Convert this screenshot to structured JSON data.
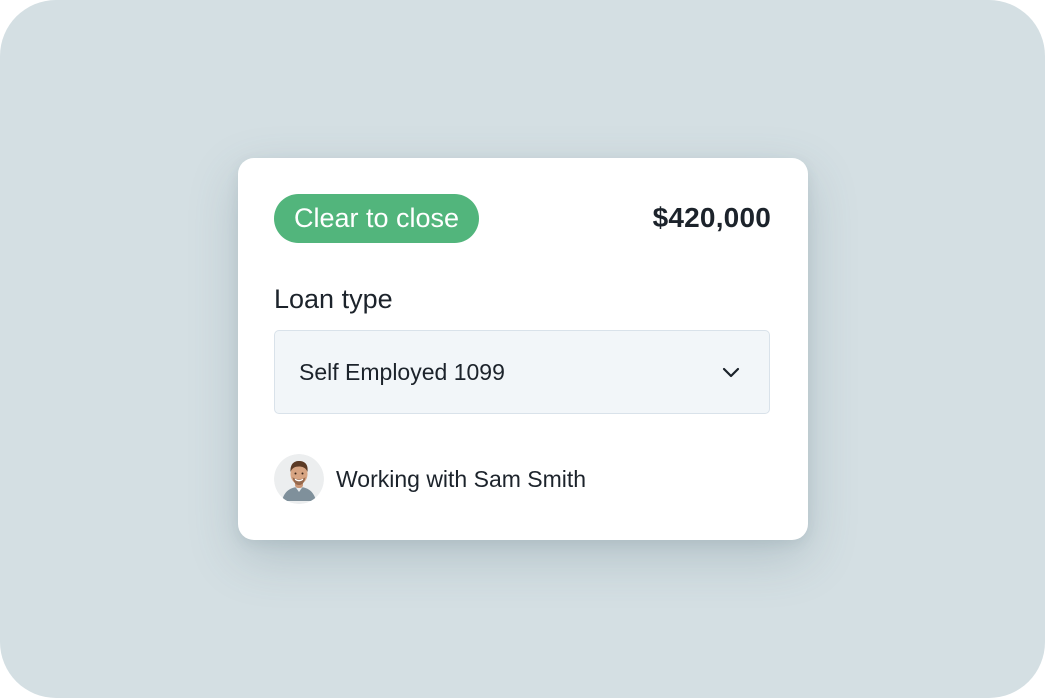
{
  "card": {
    "status_badge": "Clear to close",
    "amount": "$420,000",
    "loan_type_label": "Loan type",
    "loan_type_value": "Self Employed 1099",
    "owner_text": "Working with Sam Smith"
  },
  "icons": {
    "dropdown": "chevron-down-icon",
    "avatar": "person-avatar"
  },
  "colors": {
    "badge_green": "#52b57c",
    "background": "#d4dfe3",
    "text": "#1c232b",
    "select_bg": "#f2f6f9",
    "select_border": "#d9e2ea"
  }
}
